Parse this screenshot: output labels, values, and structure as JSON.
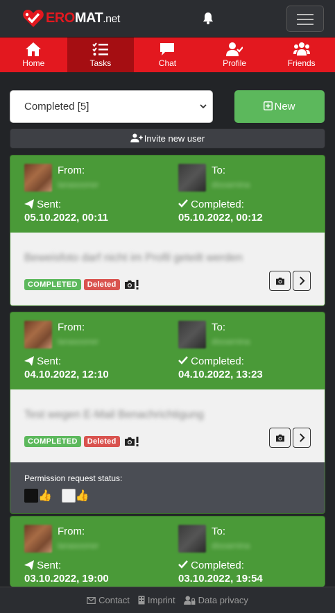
{
  "brand": {
    "ero": "ERO",
    "mat": "MAT",
    "net": ".net"
  },
  "nav": {
    "home": "Home",
    "tasks": "Tasks",
    "chat": "Chat",
    "profile": "Profile",
    "friends": "Friends"
  },
  "filter": {
    "selected": "Completed [5]"
  },
  "buttons": {
    "new": "New",
    "invite": "Invite new user"
  },
  "labels": {
    "from": "From:",
    "to": "To:",
    "sent": "Sent:",
    "completed": "Completed:",
    "permission_status": "Permission request status:"
  },
  "cards": [
    {
      "from_name": "lanasooner",
      "to_name": "disoarnina",
      "sent": "05.10.2022, 00:11",
      "completed": "05.10.2022, 00:12",
      "text": "Beweisfoto darf nicht im Profil geteilt werden",
      "status_badge": "COMPLETED",
      "deleted_badge": "Deleted"
    },
    {
      "from_name": "lanasooner",
      "to_name": "disoarnina",
      "sent": "04.10.2022, 12:10",
      "completed": "04.10.2022, 13:23",
      "text": "Test wegen E-Mail Benachrichtigung",
      "status_badge": "COMPLETED",
      "deleted_badge": "Deleted"
    },
    {
      "from_name": "lanasooner",
      "to_name": "disoarnina",
      "sent": "03.10.2022, 19:00",
      "completed": "03.10.2022, 19:54"
    }
  ],
  "footer": {
    "contact": "Contact",
    "imprint": "Imprint",
    "privacy": "Data privacy"
  },
  "colors": {
    "brand_red": "#e3181f",
    "active_tab": "#a50e12",
    "card_green": "#4a9a38",
    "new_button": "#5cb85c",
    "deleted_red": "#d9534f"
  }
}
